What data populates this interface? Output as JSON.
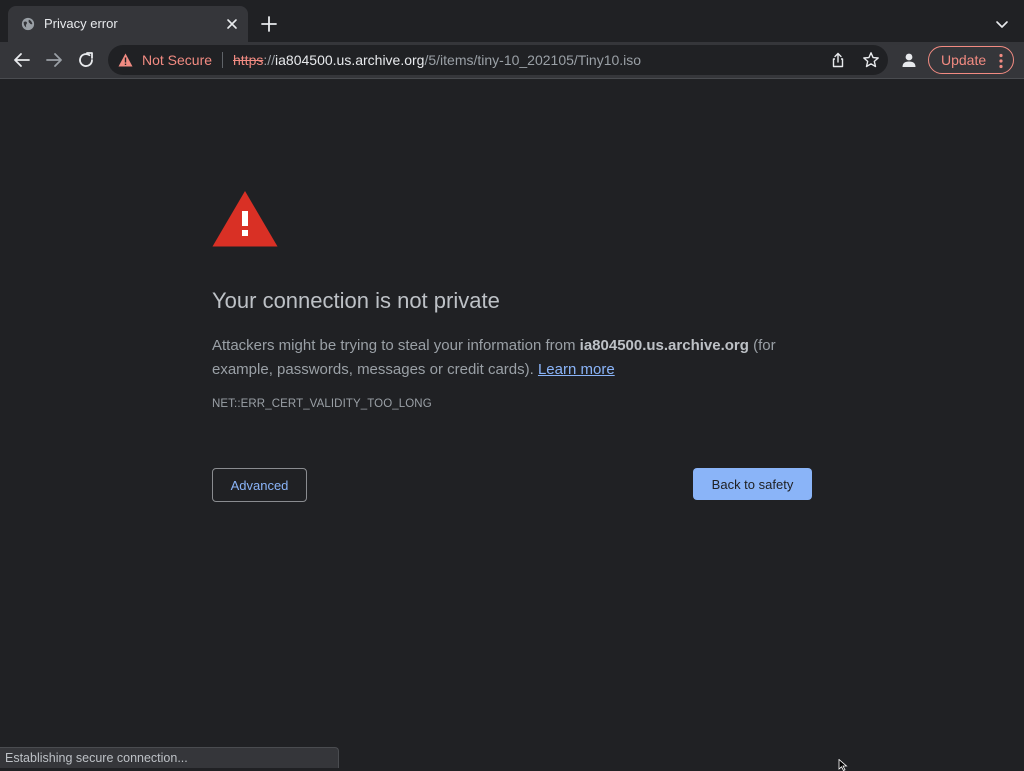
{
  "tab": {
    "title": "Privacy error",
    "favicon": "globe-icon"
  },
  "toolbar": {
    "security_label": "Not Secure",
    "url": {
      "scheme": "https",
      "separator": "://",
      "host": "ia804500.us.archive.org",
      "path": "/5/items/tiny-10_202105/Tiny10.iso"
    },
    "update_label": "Update"
  },
  "page": {
    "heading": "Your connection is not private",
    "explain_prefix": "Attackers might be trying to steal your information from ",
    "explain_host": "ia804500.us.archive.org",
    "explain_suffix": " (for example, passwords, messages or credit cards). ",
    "learn_more": "Learn more",
    "error_code": "NET::ERR_CERT_VALIDITY_TOO_LONG",
    "advanced_label": "Advanced",
    "back_label": "Back to safety"
  },
  "status_bar": {
    "text": "Establishing secure connection..."
  },
  "colors": {
    "background": "#202124",
    "toolbar": "#35363a",
    "danger": "#f28b82",
    "error_icon": "#d93025",
    "accent": "#8ab4f8"
  }
}
